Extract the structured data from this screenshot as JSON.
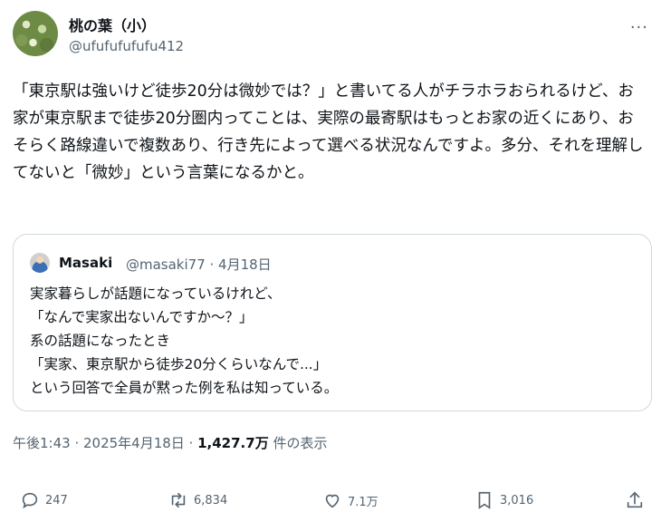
{
  "author": {
    "display_name": "桃の葉（小）",
    "handle": "@ufufufufufu412"
  },
  "more_icon": "···",
  "tweet": {
    "text": "「東京駅は強いけど徒歩20分は微妙では？」と書いてる人がチラホラおられるけど、お家が東京駅まで徒歩20分圏内ってことは、実際の最寄駅はもっとお家の近くにあり、おそらく路線違いで複数あり、行き先によって選べる状況なんですよ。多分、それを理解してないと「微妙」という言葉になるかと。"
  },
  "quote": {
    "name": "Masaki",
    "meta": "@masaki77 · 4月18日",
    "text": "実家暮らしが話題になっているけれど、\n「なんで実家出ないんですか～？」\n系の話題になったとき\n「実家、東京駅から徒歩20分くらいなんで...」\nという回答で全員が黙った例を私は知っている。"
  },
  "meta": {
    "time": "午後1:43 · 2025年4月18日 · ",
    "views": "1,427.7万",
    "views_label": " 件の表示"
  },
  "actions": {
    "reply_count": "247",
    "retweet_count": "6,834",
    "like_count": "7.1万",
    "bookmark_count": "3,016"
  }
}
